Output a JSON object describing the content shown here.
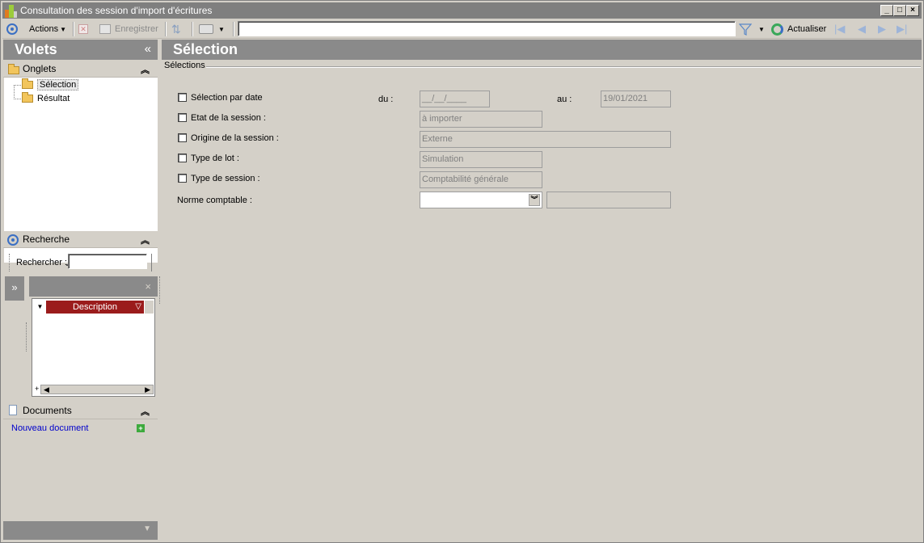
{
  "window": {
    "title": "Consultation des session d'import d'écritures",
    "controls": {
      "minimize": "_",
      "maximize": "□",
      "close": "×"
    }
  },
  "toolbar": {
    "actions_label": "Actions",
    "save_label": "Enregistrer",
    "refresh_label": "Actualiser",
    "search_value": ""
  },
  "left_panel": {
    "title": "Volets",
    "collapse_glyph": "«",
    "tabs_section": {
      "title": "Onglets",
      "items": [
        {
          "label": "Sélection",
          "selected": true
        },
        {
          "label": "Résultat",
          "selected": false
        }
      ]
    },
    "search_section": {
      "title": "Recherche",
      "search_label": "Rechercher :",
      "search_value": "",
      "expand_glyph": "»",
      "grid_close_glyph": "×",
      "grid_column": "Description"
    },
    "documents_section": {
      "title": "Documents",
      "new_document_link": "Nouveau document"
    }
  },
  "main": {
    "title": "Sélection",
    "group_legend": "Sélections",
    "fields": {
      "by_date": {
        "label": "Sélection par date",
        "checked": false
      },
      "from_label": "du :",
      "from_value": "__/__/____",
      "to_label": "au :",
      "to_value": "19/01/2021",
      "session_state": {
        "label": "Etat de la session :",
        "checked": false,
        "value": "à importer"
      },
      "session_origin": {
        "label": "Origine de la session :",
        "checked": false,
        "value": "Externe"
      },
      "batch_type": {
        "label": "Type de lot :",
        "checked": false,
        "value": "Simulation"
      },
      "session_type": {
        "label": "Type de session :",
        "checked": false,
        "value": "Comptabilité générale"
      },
      "accounting_standard": {
        "label": "Norme comptable :",
        "value": "",
        "description": ""
      }
    }
  },
  "colors": {
    "window_bg": "#d4d0c8",
    "header_gray": "#8a8a8a",
    "grid_header_red": "#9b1c1c",
    "link_blue": "#0000cc",
    "accent_blue": "#3a6fc4"
  }
}
